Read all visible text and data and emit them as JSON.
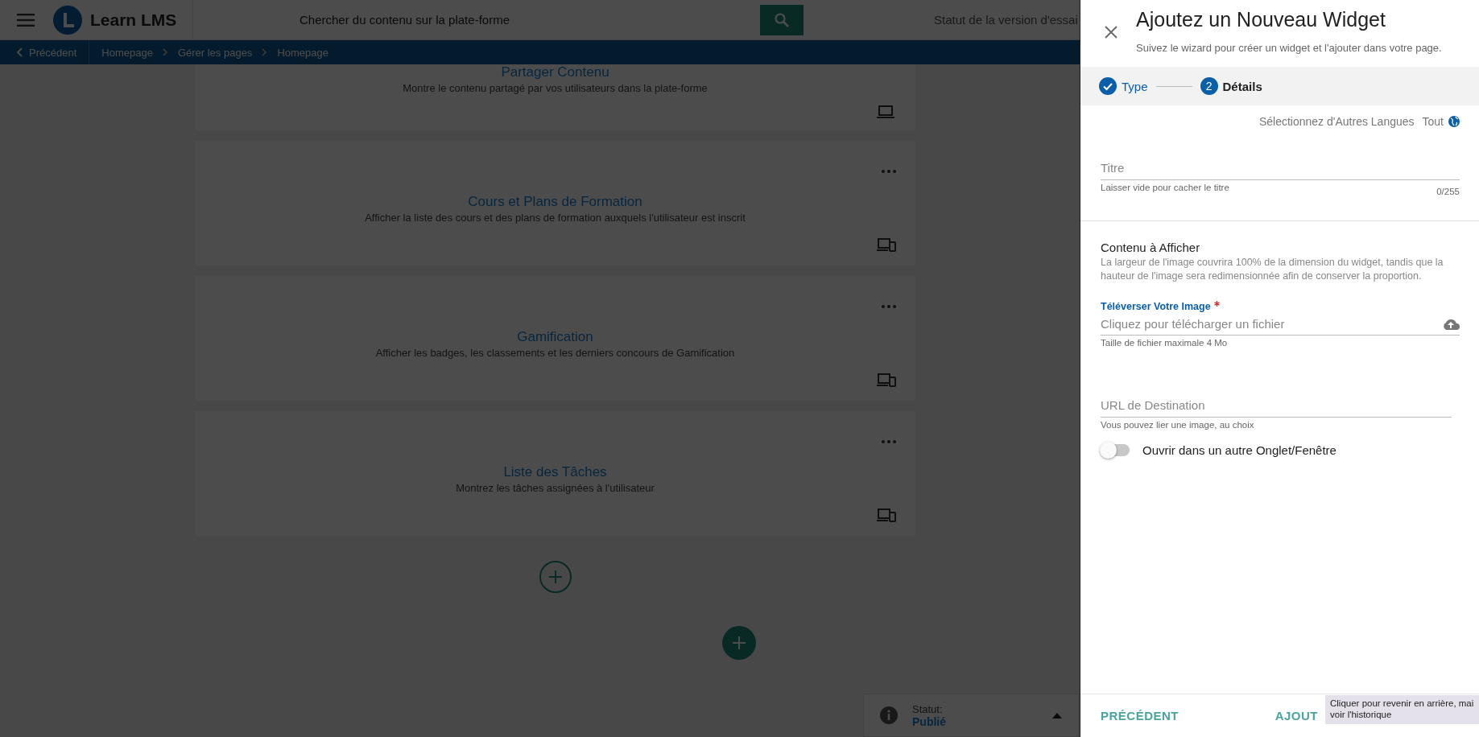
{
  "header": {
    "brand": "Learn LMS",
    "search": {
      "placeholder": "Chercher du contenu sur la plate-forme"
    },
    "trial_status": "Statut de la version d'essai"
  },
  "breadcrumb": {
    "back": "Précédent",
    "items": [
      "Homepage",
      "Gérer les pages",
      "Homepage"
    ]
  },
  "widgets": [
    {
      "title": "Partager Contenu",
      "description": "Montre le contenu partagé par vos utilisateurs dans la plate-forme",
      "kind": "desktop",
      "menu": false
    },
    {
      "title": "Cours et Plans de Formation",
      "description": "Afficher la liste des cours et des plans de formation auxquels l'utilisateur est inscrit",
      "kind": "responsive",
      "menu": true
    },
    {
      "title": "Gamification",
      "description": "Afficher les badges, les classements et les derniers concours de Gamification",
      "kind": "responsive",
      "menu": true
    },
    {
      "title": "Liste des Tâches",
      "description": "Montrez les tâches assignées à l'utilisateur",
      "kind": "responsive",
      "menu": true
    }
  ],
  "status": {
    "label": "Statut:",
    "value": "Publié"
  },
  "drawer": {
    "title": "Ajoutez un Nouveau Widget",
    "subtitle": "Suivez le wizard pour créer un widget et l'ajouter dans votre page.",
    "steps": [
      {
        "label": "Type",
        "done": true
      },
      {
        "number": "2",
        "label": "Détails",
        "done": false
      }
    ],
    "languages": {
      "label": "Sélectionnez d'Autres Langues",
      "value": "Tout"
    },
    "title_field": {
      "placeholder": "Titre",
      "hint": "Laisser vide pour cacher le titre",
      "counter": "0/255"
    },
    "content": {
      "heading": "Contenu à Afficher",
      "description": "La largeur de l'image couvrira 100% de la dimension du widget, tandis que la hauteur de l'image sera redimensionnée afin de conserver la proportion."
    },
    "upload": {
      "label": "Téléverser Votre Image",
      "required": true,
      "placeholder": "Cliquez pour télécharger un fichier",
      "hint": "Taille de fichier maximale 4 Mo"
    },
    "url_field": {
      "placeholder": "URL de Destination",
      "hint": "Vous pouvez lier une image, au choix"
    },
    "toggle": {
      "label": "Ouvrir dans un autre Onglet/Fenêtre",
      "on": false
    },
    "footer": {
      "back": "PRÉCÉDENT",
      "next": "AJOUT"
    },
    "tooltip": {
      "lines": [
        "Cliquer pour revenir en arrière, mai",
        "voir l'historique"
      ]
    }
  }
}
